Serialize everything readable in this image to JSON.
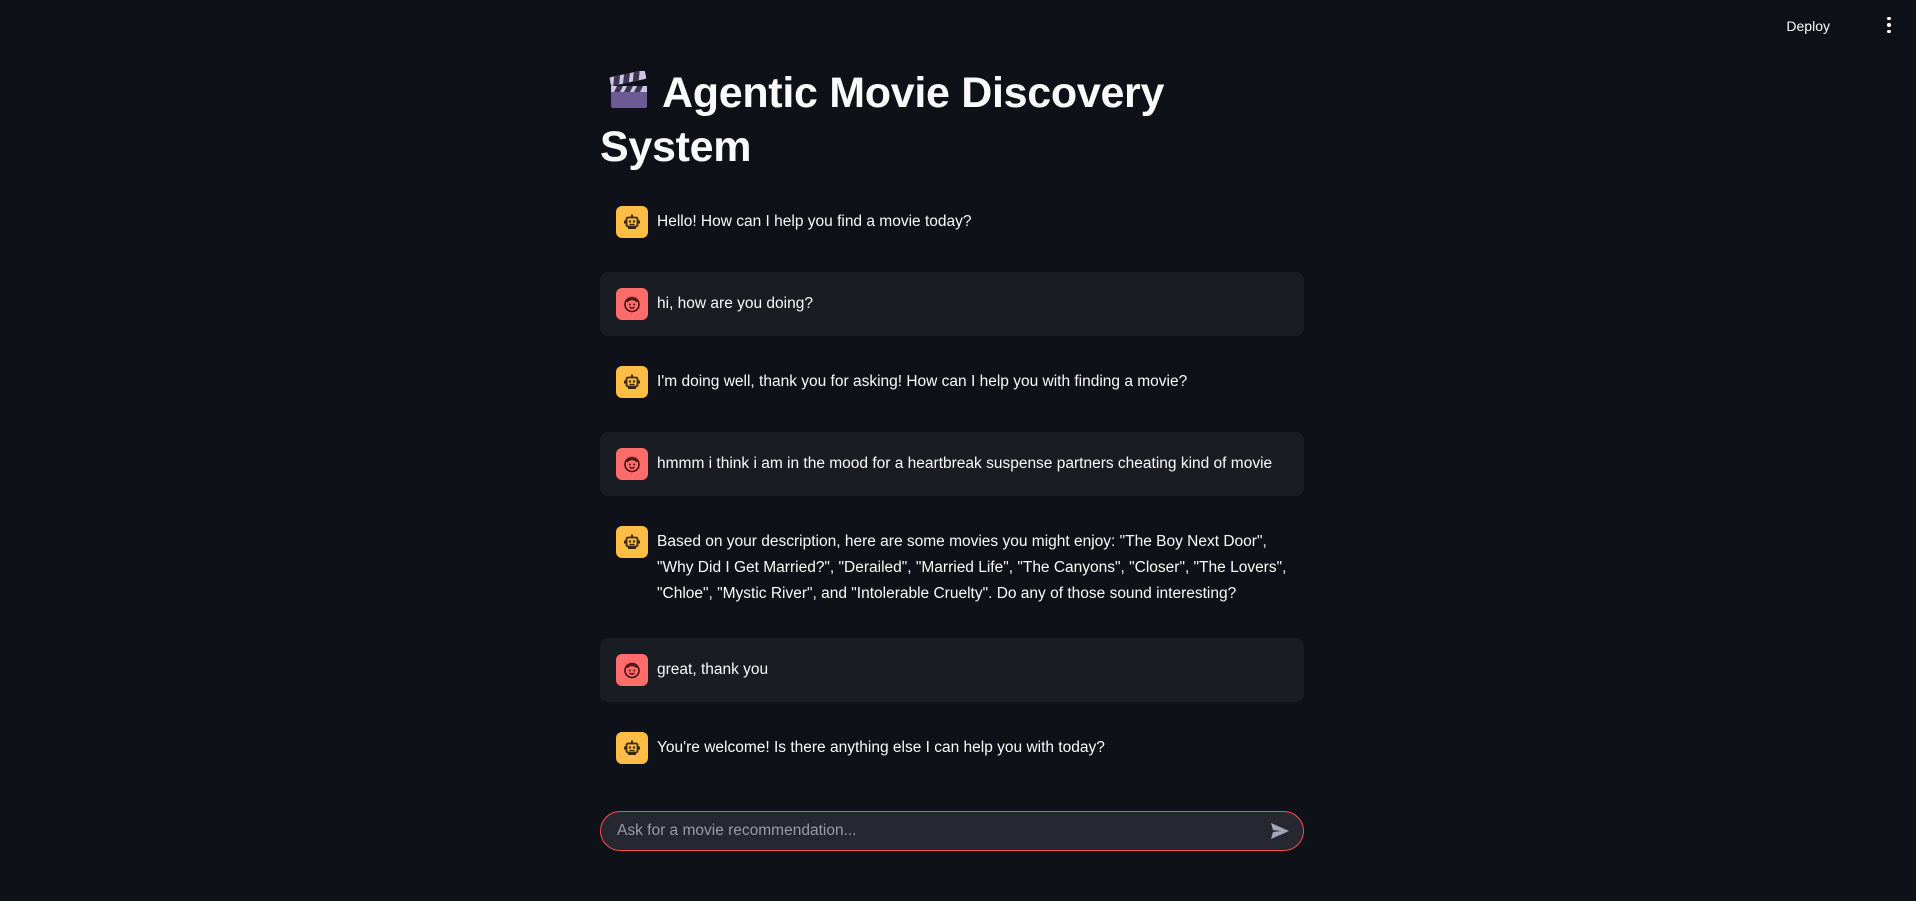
{
  "header": {
    "deploy_label": "Deploy"
  },
  "page": {
    "title": "Agentic Movie Discovery System",
    "title_icon": "clapper-board-icon"
  },
  "colors": {
    "background": "#0e1117",
    "user_bubble": "#1a1c24",
    "bot_avatar": "#ffbd45",
    "user_avatar": "#ff6c6c",
    "input_border": "#ff4b4b",
    "input_background": "#262730"
  },
  "messages": [
    {
      "role": "assistant",
      "avatar_icon": "robot-icon",
      "text": "Hello! How can I help you find a movie today?"
    },
    {
      "role": "user",
      "avatar_icon": "smiley-face-icon",
      "text": "hi, how are you doing?"
    },
    {
      "role": "assistant",
      "avatar_icon": "robot-icon",
      "text": "I'm doing well, thank you for asking! How can I help you with finding a movie?"
    },
    {
      "role": "user",
      "avatar_icon": "smiley-face-icon",
      "text": "hmmm i think i am in the mood for a heartbreak suspense partners cheating kind of movie"
    },
    {
      "role": "assistant",
      "avatar_icon": "robot-icon",
      "text": "Based on your description, here are some movies you might enjoy: \"The Boy Next Door\", \"Why Did I Get Married?\", \"Derailed\", \"Married Life\", \"The Canyons\", \"Closer\", \"The Lovers\", \"Chloe\", \"Mystic River\", and \"Intolerable Cruelty\". Do any of those sound interesting?"
    },
    {
      "role": "user",
      "avatar_icon": "smiley-face-icon",
      "text": "great, thank you"
    },
    {
      "role": "assistant",
      "avatar_icon": "robot-icon",
      "text": "You're welcome! Is there anything else I can help you with today?"
    }
  ],
  "chat_input": {
    "placeholder": "Ask for a movie recommendation...",
    "value": "",
    "send_icon": "send-icon"
  }
}
